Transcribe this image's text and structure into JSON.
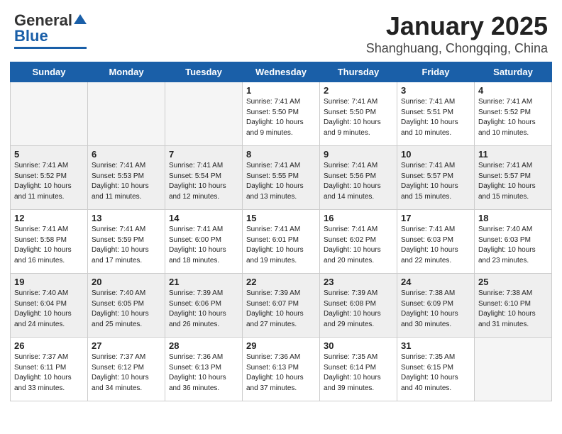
{
  "header": {
    "logo_general": "General",
    "logo_blue": "Blue",
    "month": "January 2025",
    "location": "Shanghuang, Chongqing, China"
  },
  "days": [
    "Sunday",
    "Monday",
    "Tuesday",
    "Wednesday",
    "Thursday",
    "Friday",
    "Saturday"
  ],
  "weeks": [
    [
      {
        "num": "",
        "text": ""
      },
      {
        "num": "",
        "text": ""
      },
      {
        "num": "",
        "text": ""
      },
      {
        "num": "1",
        "text": "Sunrise: 7:41 AM\nSunset: 5:50 PM\nDaylight: 10 hours\nand 9 minutes."
      },
      {
        "num": "2",
        "text": "Sunrise: 7:41 AM\nSunset: 5:50 PM\nDaylight: 10 hours\nand 9 minutes."
      },
      {
        "num": "3",
        "text": "Sunrise: 7:41 AM\nSunset: 5:51 PM\nDaylight: 10 hours\nand 10 minutes."
      },
      {
        "num": "4",
        "text": "Sunrise: 7:41 AM\nSunset: 5:52 PM\nDaylight: 10 hours\nand 10 minutes."
      }
    ],
    [
      {
        "num": "5",
        "text": "Sunrise: 7:41 AM\nSunset: 5:52 PM\nDaylight: 10 hours\nand 11 minutes."
      },
      {
        "num": "6",
        "text": "Sunrise: 7:41 AM\nSunset: 5:53 PM\nDaylight: 10 hours\nand 11 minutes."
      },
      {
        "num": "7",
        "text": "Sunrise: 7:41 AM\nSunset: 5:54 PM\nDaylight: 10 hours\nand 12 minutes."
      },
      {
        "num": "8",
        "text": "Sunrise: 7:41 AM\nSunset: 5:55 PM\nDaylight: 10 hours\nand 13 minutes."
      },
      {
        "num": "9",
        "text": "Sunrise: 7:41 AM\nSunset: 5:56 PM\nDaylight: 10 hours\nand 14 minutes."
      },
      {
        "num": "10",
        "text": "Sunrise: 7:41 AM\nSunset: 5:57 PM\nDaylight: 10 hours\nand 15 minutes."
      },
      {
        "num": "11",
        "text": "Sunrise: 7:41 AM\nSunset: 5:57 PM\nDaylight: 10 hours\nand 15 minutes."
      }
    ],
    [
      {
        "num": "12",
        "text": "Sunrise: 7:41 AM\nSunset: 5:58 PM\nDaylight: 10 hours\nand 16 minutes."
      },
      {
        "num": "13",
        "text": "Sunrise: 7:41 AM\nSunset: 5:59 PM\nDaylight: 10 hours\nand 17 minutes."
      },
      {
        "num": "14",
        "text": "Sunrise: 7:41 AM\nSunset: 6:00 PM\nDaylight: 10 hours\nand 18 minutes."
      },
      {
        "num": "15",
        "text": "Sunrise: 7:41 AM\nSunset: 6:01 PM\nDaylight: 10 hours\nand 19 minutes."
      },
      {
        "num": "16",
        "text": "Sunrise: 7:41 AM\nSunset: 6:02 PM\nDaylight: 10 hours\nand 20 minutes."
      },
      {
        "num": "17",
        "text": "Sunrise: 7:41 AM\nSunset: 6:03 PM\nDaylight: 10 hours\nand 22 minutes."
      },
      {
        "num": "18",
        "text": "Sunrise: 7:40 AM\nSunset: 6:03 PM\nDaylight: 10 hours\nand 23 minutes."
      }
    ],
    [
      {
        "num": "19",
        "text": "Sunrise: 7:40 AM\nSunset: 6:04 PM\nDaylight: 10 hours\nand 24 minutes."
      },
      {
        "num": "20",
        "text": "Sunrise: 7:40 AM\nSunset: 6:05 PM\nDaylight: 10 hours\nand 25 minutes."
      },
      {
        "num": "21",
        "text": "Sunrise: 7:39 AM\nSunset: 6:06 PM\nDaylight: 10 hours\nand 26 minutes."
      },
      {
        "num": "22",
        "text": "Sunrise: 7:39 AM\nSunset: 6:07 PM\nDaylight: 10 hours\nand 27 minutes."
      },
      {
        "num": "23",
        "text": "Sunrise: 7:39 AM\nSunset: 6:08 PM\nDaylight: 10 hours\nand 29 minutes."
      },
      {
        "num": "24",
        "text": "Sunrise: 7:38 AM\nSunset: 6:09 PM\nDaylight: 10 hours\nand 30 minutes."
      },
      {
        "num": "25",
        "text": "Sunrise: 7:38 AM\nSunset: 6:10 PM\nDaylight: 10 hours\nand 31 minutes."
      }
    ],
    [
      {
        "num": "26",
        "text": "Sunrise: 7:37 AM\nSunset: 6:11 PM\nDaylight: 10 hours\nand 33 minutes."
      },
      {
        "num": "27",
        "text": "Sunrise: 7:37 AM\nSunset: 6:12 PM\nDaylight: 10 hours\nand 34 minutes."
      },
      {
        "num": "28",
        "text": "Sunrise: 7:36 AM\nSunset: 6:13 PM\nDaylight: 10 hours\nand 36 minutes."
      },
      {
        "num": "29",
        "text": "Sunrise: 7:36 AM\nSunset: 6:13 PM\nDaylight: 10 hours\nand 37 minutes."
      },
      {
        "num": "30",
        "text": "Sunrise: 7:35 AM\nSunset: 6:14 PM\nDaylight: 10 hours\nand 39 minutes."
      },
      {
        "num": "31",
        "text": "Sunrise: 7:35 AM\nSunset: 6:15 PM\nDaylight: 10 hours\nand 40 minutes."
      },
      {
        "num": "",
        "text": ""
      }
    ]
  ]
}
